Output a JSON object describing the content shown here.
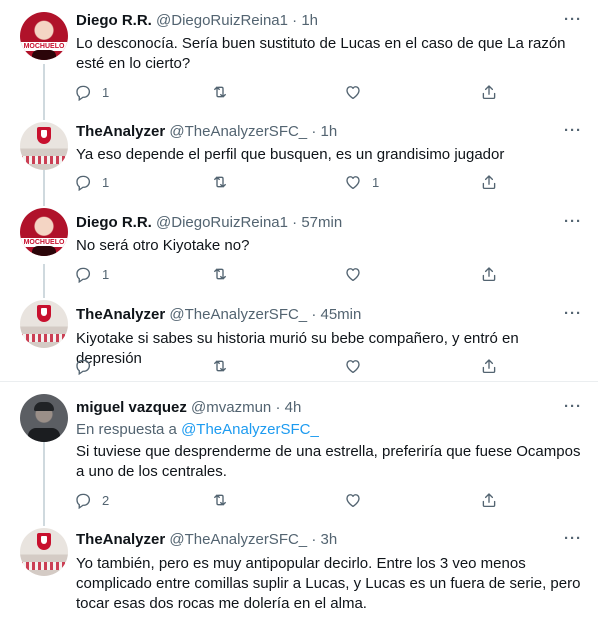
{
  "tweets": [
    {
      "name": "Diego R.R.",
      "handle": "@DiegoRuizReina1",
      "dot": "·",
      "time": "1h",
      "avatar": "diego-avatar",
      "text": "Lo desconocía. Sería buen sustituto de Lucas en el caso de que La razón esté en lo cierto?",
      "replies": "1",
      "retweets": "",
      "likes": ""
    },
    {
      "name": "TheAnalyzer",
      "handle": "@TheAnalyzerSFC_",
      "dot": "·",
      "time": "1h",
      "avatar": "analyzer-avatar",
      "text": "Ya eso depende el perfil que busquen, es un grandisimo jugador",
      "replies": "1",
      "retweets": "",
      "likes": "1"
    },
    {
      "name": "Diego R.R.",
      "handle": "@DiegoRuizReina1",
      "dot": "·",
      "time": "57min",
      "avatar": "diego-avatar",
      "text": "No será otro Kiyotake no?",
      "replies": "1",
      "retweets": "",
      "likes": ""
    },
    {
      "name": "TheAnalyzer",
      "handle": "@TheAnalyzerSFC_",
      "dot": "·",
      "time": "45min",
      "avatar": "analyzer-avatar",
      "text": "Kiyotake si sabes su historia murió su bebe compañero, y entró en depresión",
      "replies": "",
      "retweets": "",
      "likes": ""
    },
    {
      "name": "miguel vazquez",
      "handle": "@mvazmun",
      "dot": "·",
      "time": "4h",
      "avatar": "miguel-avatar",
      "reply_prefix": "En respuesta a",
      "reply_mention": "@TheAnalyzerSFC_",
      "text": "Si tuviese que desprenderme de una estrella, preferiría que fuese Ocampos a uno de los centrales.",
      "replies": "2",
      "retweets": "",
      "likes": ""
    },
    {
      "name": "TheAnalyzer",
      "handle": "@TheAnalyzerSFC_",
      "dot": "·",
      "time": "3h",
      "avatar": "analyzer-avatar",
      "text": "Yo también, pero es muy antipopular decirlo. Entre los 3 veo menos complicado entre comillas suplir a Lucas, y Lucas es un fuera de serie, pero tocar esas dos rocas me dolería en el alma.",
      "replies": "",
      "retweets": "",
      "likes": ""
    }
  ],
  "avatar_text": {
    "diego": "MOCHUELO"
  },
  "more_label": "···",
  "icons": [
    "reply-icon",
    "retweet-icon",
    "like-icon",
    "share-icon",
    "more-icon"
  ],
  "colors": {
    "text": "#0f1419",
    "muted": "#536471",
    "link": "#1d9bf0",
    "divider": "#ebeef0",
    "thread": "#cfd9de"
  }
}
